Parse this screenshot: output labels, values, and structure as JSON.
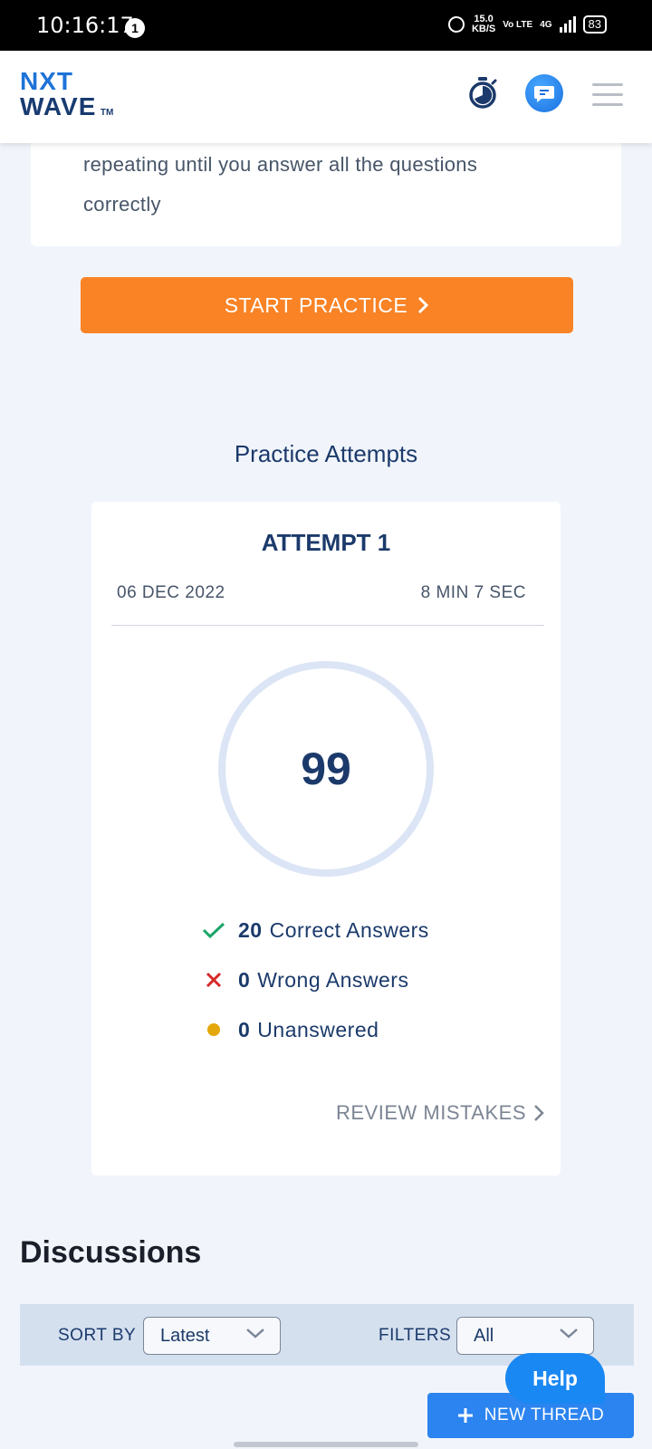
{
  "status_bar": {
    "time": "10:16:17",
    "notification_count": "1",
    "net_speed_value": "15.0",
    "net_speed_unit": "KB/S",
    "volte": "Vo LTE",
    "network": "4G",
    "battery": "83"
  },
  "header": {
    "logo_line1": "NXT",
    "logo_line2": "WAVE",
    "logo_tm": "TM",
    "icons": [
      "timer-icon",
      "chat-icon",
      "menu-icon"
    ]
  },
  "instructions": {
    "text": "repeating until you answer all the questions correctly"
  },
  "start_button": {
    "label": "START PRACTICE"
  },
  "practice_attempts": {
    "title": "Practice Attempts",
    "attempt": {
      "title": "ATTEMPT 1",
      "date": "06 DEC 2022",
      "duration": "8 MIN 7 SEC",
      "score": "99",
      "correct_count": "20",
      "correct_label": "Correct Answers",
      "wrong_count": "0",
      "wrong_label": "Wrong Answers",
      "unanswered_count": "0",
      "unanswered_label": "Unanswered",
      "review_label": "REVIEW MISTAKES"
    }
  },
  "discussions": {
    "title": "Discussions",
    "sort_label": "SORT BY",
    "sort_value": "Latest",
    "filters_label": "FILTERS",
    "filters_value": "All",
    "help_label": "Help",
    "new_thread_label": "NEW THREAD"
  },
  "colors": {
    "accent_orange": "#f98325",
    "brand_navy": "#1b3a6b",
    "brand_blue": "#1e73d8",
    "correct_green": "#1aa568",
    "wrong_red": "#d62828",
    "unanswered_yellow": "#e4a70b"
  }
}
